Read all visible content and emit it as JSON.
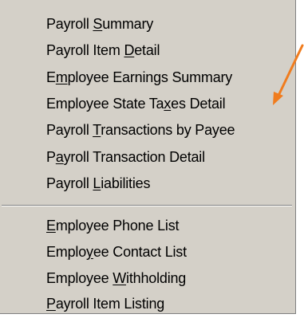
{
  "menu": {
    "groups": [
      {
        "items": [
          {
            "pre": "Payroll ",
            "key": "S",
            "post": "ummary"
          },
          {
            "pre": "Payroll Item ",
            "key": "D",
            "post": "etail"
          },
          {
            "pre": "E",
            "key": "m",
            "post": "ployee Earnings Summary"
          },
          {
            "pre": "Employee State Ta",
            "key": "x",
            "post": "es Detail"
          },
          {
            "pre": "Payroll ",
            "key": "T",
            "post": "ransactions by Payee"
          },
          {
            "pre": "P",
            "key": "a",
            "post": "yroll Transaction Detail"
          },
          {
            "pre": "Payroll ",
            "key": "L",
            "post": "iabilities"
          }
        ]
      },
      {
        "items": [
          {
            "pre": "",
            "key": "E",
            "post": "mployee Phone List"
          },
          {
            "pre": "Emplo",
            "key": "y",
            "post": "ee Contact List"
          },
          {
            "pre": "Employee ",
            "key": "W",
            "post": "ithholding"
          },
          {
            "pre": "",
            "key": "P",
            "post": "ayroll Item Listing"
          }
        ]
      }
    ]
  },
  "annotation": {
    "color": "#f07c1e",
    "icon": "arrow-annotation-icon"
  }
}
